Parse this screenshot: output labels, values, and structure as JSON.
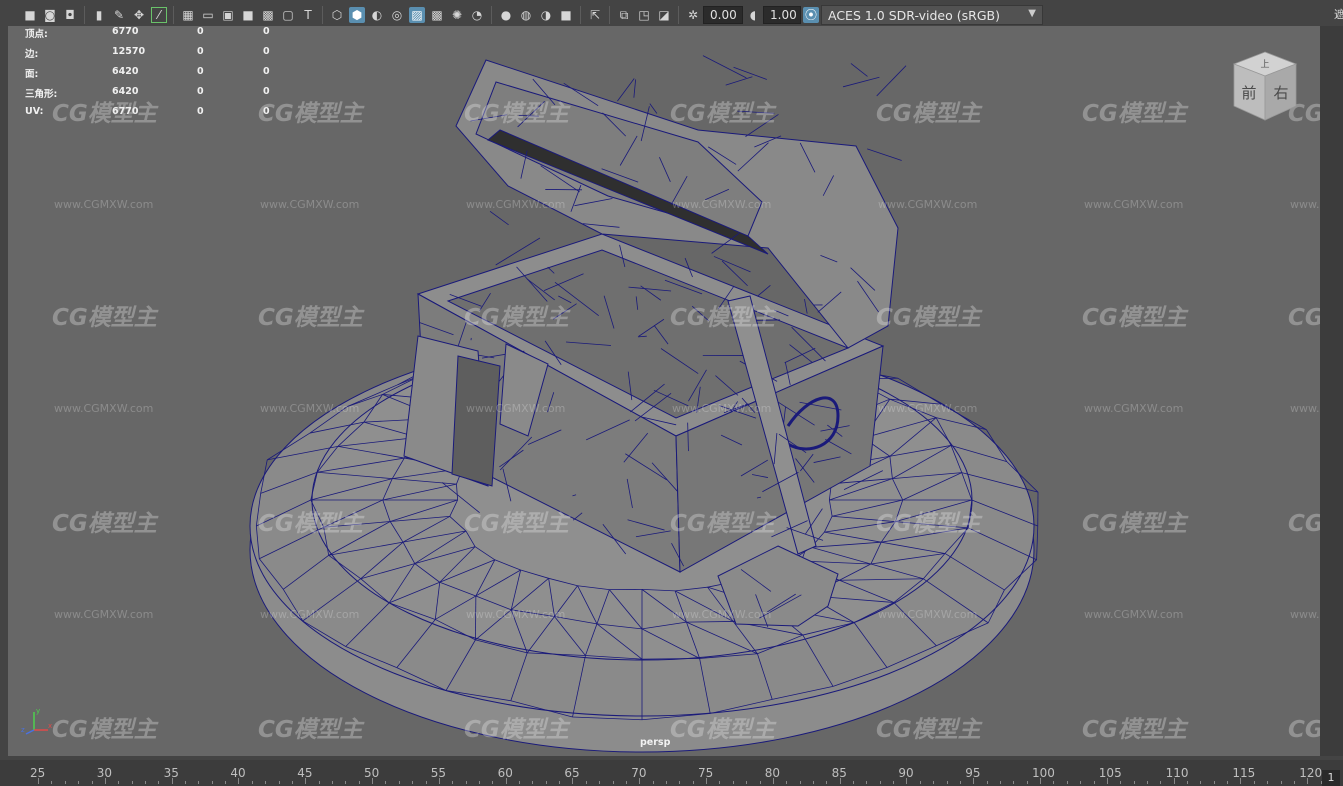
{
  "toolbar": {
    "icons": [
      "camera-icon",
      "camera-attr-icon",
      "bookmark-icon",
      "image-plane-icon",
      "grease-pencil-icon",
      "pan-zoom-icon",
      "isolate-icon",
      "grid-icon",
      "film-gate-icon",
      "resolution-gate-icon",
      "gate-mask-icon",
      "field-chart-icon",
      "safe-action-icon",
      "safe-title-icon",
      "wireframe-icon",
      "smooth-shade-icon",
      "default-material-icon",
      "wireframe-on-shaded-icon",
      "textured-icon",
      "use-all-lights-icon",
      "shadows-icon",
      "screen-space-ao-icon",
      "motion-blur-icon",
      "anti-aliasing-icon",
      "depth-of-field-icon",
      "xray-icon",
      "xray-joints-icon",
      "xray-active-icon",
      "backface-culling-icon",
      "exposure-icon",
      "gamma-icon",
      "color-management-icon"
    ],
    "exposure_value": "0.00",
    "gamma_value": "1.00",
    "color_space": "ACES 1.0 SDR-video (sRGB)"
  },
  "hud": {
    "rows": [
      {
        "label": "顶点:",
        "v1": "6770",
        "v2": "0",
        "v3": "0"
      },
      {
        "label": "边:",
        "v1": "12570",
        "v2": "0",
        "v3": "0"
      },
      {
        "label": "面:",
        "v1": "6420",
        "v2": "0",
        "v3": "0"
      },
      {
        "label": "三角形:",
        "v1": "6420",
        "v2": "0",
        "v3": "0"
      },
      {
        "label": "UV:",
        "v1": "6770",
        "v2": "0",
        "v3": "0"
      }
    ]
  },
  "viewcube": {
    "top": "上",
    "front": "前",
    "right": "右"
  },
  "axis": {
    "y": "y",
    "x": "x",
    "z": "z"
  },
  "camera_label": "persp",
  "watermark": {
    "logo": "CG模型主",
    "url": "www.CGMXW.com"
  },
  "right_edge_char": "遮",
  "timeline": {
    "ticks": [
      "25",
      "30",
      "35",
      "40",
      "45",
      "50",
      "55",
      "60",
      "65",
      "70",
      "75",
      "80",
      "85",
      "90",
      "95",
      "100",
      "105",
      "110",
      "115",
      "120"
    ],
    "current_frame": "1"
  },
  "colors": {
    "viewport_bg": "#676767",
    "wire": "#1a1a7a",
    "accent": "#5a8fb0"
  }
}
